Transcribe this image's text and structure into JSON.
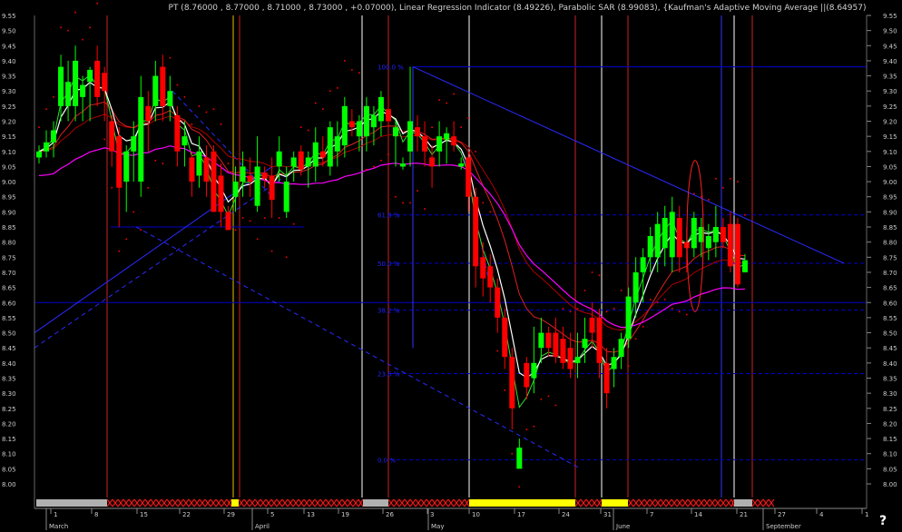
{
  "header": {
    "title": "PT (8.76000 , 8.77000 , 8.71000 , 8.73000 , +0.07000), Linear Regression Indicator (8.49226), Parabolic SAR (8.99083), {Kaufman's Adaptive Moving Average ||(8.64957)"
  },
  "help_label": "?",
  "colors": {
    "background": "#000000",
    "up_candle": "#00ff00",
    "down_candle": "#ff0000",
    "fib_line": "#0000cc",
    "regression": "#ffffff",
    "kama": "#ff00ff",
    "sar": "#ff0000",
    "vline_white": "#ffffff",
    "vline_red": "#cc2222",
    "vline_yellow": "#e8c000",
    "vline_blue": "#3333ff",
    "grid_label": "#cccccc"
  },
  "chart_data": {
    "type": "candlestick",
    "y_ticks": [
      "9.55",
      "9.50",
      "9.45",
      "9.40",
      "9.35",
      "9.30",
      "9.25",
      "9.20",
      "9.15",
      "9.10",
      "9.05",
      "9.00",
      "8.95",
      "8.90",
      "8.85",
      "8.80",
      "8.75",
      "8.70",
      "8.65",
      "8.60",
      "8.55",
      "8.50",
      "8.45",
      "8.40",
      "8.35",
      "8.30",
      "8.25",
      "8.20",
      "8.15",
      "8.10",
      "8.05",
      "8.00"
    ],
    "ylim": [
      7.96,
      9.58
    ],
    "fib_labels": [
      "100.0 %",
      "61.8 %",
      "50.0 %",
      "38.2 %",
      "23.6 %",
      "0.0 %"
    ],
    "fib_levels": [
      9.38,
      8.89,
      8.73,
      8.575,
      8.365,
      8.08
    ],
    "month_labels": [
      "March",
      "April",
      "May",
      "June",
      "September"
    ],
    "day_labels": [
      "1",
      "8",
      "15",
      "22",
      "29",
      "5",
      "13",
      "19",
      "26",
      "3",
      "10",
      "17",
      "24",
      "31",
      "7",
      "14",
      "21",
      "27",
      "4",
      "1"
    ],
    "candles": [
      {
        "o": 9.08,
        "h": 9.12,
        "l": 9.06,
        "c": 9.1
      },
      {
        "o": 9.1,
        "h": 9.17,
        "l": 9.08,
        "c": 9.13
      },
      {
        "o": 9.13,
        "h": 9.2,
        "l": 9.08,
        "c": 9.17
      },
      {
        "o": 9.25,
        "h": 9.42,
        "l": 9.2,
        "c": 9.38
      },
      {
        "o": 9.25,
        "h": 9.4,
        "l": 9.2,
        "c": 9.33
      },
      {
        "o": 9.25,
        "h": 9.45,
        "l": 9.2,
        "c": 9.4
      },
      {
        "o": 9.28,
        "h": 9.35,
        "l": 9.2,
        "c": 9.32
      },
      {
        "o": 9.33,
        "h": 9.38,
        "l": 9.2,
        "c": 9.37
      },
      {
        "o": 9.4,
        "h": 9.45,
        "l": 9.25,
        "c": 9.28
      },
      {
        "o": 9.36,
        "h": 9.38,
        "l": 9.2,
        "c": 9.3
      },
      {
        "o": 9.2,
        "h": 9.22,
        "l": 9.05,
        "c": 9.1
      },
      {
        "o": 9.15,
        "h": 9.18,
        "l": 8.85,
        "c": 8.98
      },
      {
        "o": 9.0,
        "h": 9.12,
        "l": 8.9,
        "c": 9.1
      },
      {
        "o": 9.1,
        "h": 9.2,
        "l": 9.0,
        "c": 9.15
      },
      {
        "o": 9.0,
        "h": 9.35,
        "l": 8.95,
        "c": 9.28
      },
      {
        "o": 9.25,
        "h": 9.3,
        "l": 9.1,
        "c": 9.2
      },
      {
        "o": 9.25,
        "h": 9.4,
        "l": 9.2,
        "c": 9.35
      },
      {
        "o": 9.38,
        "h": 9.42,
        "l": 9.2,
        "c": 9.25
      },
      {
        "o": 9.25,
        "h": 9.35,
        "l": 9.2,
        "c": 9.3
      },
      {
        "o": 9.22,
        "h": 9.25,
        "l": 9.05,
        "c": 9.1
      },
      {
        "o": 9.12,
        "h": 9.2,
        "l": 9.05,
        "c": 9.15
      },
      {
        "o": 9.08,
        "h": 9.1,
        "l": 8.95,
        "c": 9.0
      },
      {
        "o": 9.02,
        "h": 9.15,
        "l": 8.98,
        "c": 9.1
      },
      {
        "o": 9.08,
        "h": 9.12,
        "l": 8.95,
        "c": 9.0
      },
      {
        "o": 9.1,
        "h": 9.12,
        "l": 8.95,
        "c": 8.9
      },
      {
        "o": 9.02,
        "h": 9.06,
        "l": 8.85,
        "c": 8.9
      },
      {
        "o": 8.9,
        "h": 8.92,
        "l": 8.84,
        "c": 8.84
      },
      {
        "o": 8.95,
        "h": 9.05,
        "l": 8.9,
        "c": 9.0
      },
      {
        "o": 9.0,
        "h": 9.1,
        "l": 8.95,
        "c": 9.05
      },
      {
        "o": 9.02,
        "h": 9.08,
        "l": 8.95,
        "c": 9.0
      },
      {
        "o": 8.92,
        "h": 9.15,
        "l": 8.9,
        "c": 9.05
      },
      {
        "o": 9.03,
        "h": 9.05,
        "l": 8.98,
        "c": 9.01
      },
      {
        "o": 9.02,
        "h": 9.08,
        "l": 8.88,
        "c": 8.94
      },
      {
        "o": 9.05,
        "h": 9.15,
        "l": 9.0,
        "c": 9.1
      },
      {
        "o": 8.9,
        "h": 9.05,
        "l": 8.88,
        "c": 9.0
      },
      {
        "o": 9.05,
        "h": 9.1,
        "l": 9.0,
        "c": 9.08
      },
      {
        "o": 9.1,
        "h": 9.12,
        "l": 9.02,
        "c": 9.04
      },
      {
        "o": 9.05,
        "h": 9.1,
        "l": 8.98,
        "c": 9.08
      },
      {
        "o": 9.05,
        "h": 9.18,
        "l": 9.0,
        "c": 9.13
      },
      {
        "o": 9.1,
        "h": 9.15,
        "l": 9.05,
        "c": 9.08
      },
      {
        "o": 9.05,
        "h": 9.2,
        "l": 9.02,
        "c": 9.18
      },
      {
        "o": 9.1,
        "h": 9.2,
        "l": 9.05,
        "c": 9.15
      },
      {
        "o": 9.12,
        "h": 9.28,
        "l": 9.08,
        "c": 9.25
      },
      {
        "o": 9.2,
        "h": 9.24,
        "l": 9.15,
        "c": 9.18
      },
      {
        "o": 9.15,
        "h": 9.22,
        "l": 9.1,
        "c": 9.2
      },
      {
        "o": 9.15,
        "h": 9.28,
        "l": 9.1,
        "c": 9.25
      },
      {
        "o": 9.18,
        "h": 9.25,
        "l": 9.12,
        "c": 9.22
      },
      {
        "o": 9.2,
        "h": 9.3,
        "l": 9.15,
        "c": 9.28
      },
      {
        "o": 9.24,
        "h": 9.28,
        "l": 9.18,
        "c": 9.2
      },
      {
        "o": 9.15,
        "h": 9.2,
        "l": 9.05,
        "c": 9.18
      },
      {
        "o": 9.05,
        "h": 9.08,
        "l": 9.04,
        "c": 9.06
      },
      {
        "o": 9.1,
        "h": 9.38,
        "l": 9.05,
        "c": 9.2
      },
      {
        "o": 9.18,
        "h": 9.22,
        "l": 9.1,
        "c": 9.15
      },
      {
        "o": 9.15,
        "h": 9.2,
        "l": 9.05,
        "c": 9.1
      },
      {
        "o": 9.08,
        "h": 9.12,
        "l": 8.98,
        "c": 9.05
      },
      {
        "o": 9.1,
        "h": 9.2,
        "l": 9.05,
        "c": 9.15
      },
      {
        "o": 9.14,
        "h": 9.18,
        "l": 9.06,
        "c": 9.16
      },
      {
        "o": 9.15,
        "h": 9.2,
        "l": 9.1,
        "c": 9.12
      },
      {
        "o": 9.05,
        "h": 9.08,
        "l": 9.04,
        "c": 9.06
      },
      {
        "o": 9.08,
        "h": 9.1,
        "l": 8.9,
        "c": 8.95
      },
      {
        "o": 8.95,
        "h": 8.98,
        "l": 8.65,
        "c": 8.72
      },
      {
        "o": 8.75,
        "h": 8.8,
        "l": 8.62,
        "c": 8.68
      },
      {
        "o": 8.72,
        "h": 8.76,
        "l": 8.6,
        "c": 8.65
      },
      {
        "o": 8.65,
        "h": 8.68,
        "l": 8.5,
        "c": 8.55
      },
      {
        "o": 8.55,
        "h": 8.58,
        "l": 8.38,
        "c": 8.42
      },
      {
        "o": 8.42,
        "h": 8.45,
        "l": 8.18,
        "c": 8.25
      },
      {
        "o": 8.05,
        "h": 8.15,
        "l": 8.08,
        "c": 8.12
      },
      {
        "o": 8.4,
        "h": 8.42,
        "l": 8.28,
        "c": 8.32
      },
      {
        "o": 8.35,
        "h": 8.52,
        "l": 8.3,
        "c": 8.4
      },
      {
        "o": 8.45,
        "h": 8.55,
        "l": 8.4,
        "c": 8.5
      },
      {
        "o": 8.5,
        "h": 8.52,
        "l": 8.42,
        "c": 8.45
      },
      {
        "o": 8.5,
        "h": 8.55,
        "l": 8.4,
        "c": 8.42
      },
      {
        "o": 8.48,
        "h": 8.52,
        "l": 8.38,
        "c": 8.4
      },
      {
        "o": 8.45,
        "h": 8.5,
        "l": 8.35,
        "c": 8.38
      },
      {
        "o": 8.4,
        "h": 8.5,
        "l": 8.35,
        "c": 8.42
      },
      {
        "o": 8.45,
        "h": 8.55,
        "l": 8.4,
        "c": 8.48
      },
      {
        "o": 8.55,
        "h": 8.6,
        "l": 8.45,
        "c": 8.5
      },
      {
        "o": 8.55,
        "h": 8.58,
        "l": 8.35,
        "c": 8.4
      },
      {
        "o": 8.4,
        "h": 8.45,
        "l": 8.25,
        "c": 8.3
      },
      {
        "o": 8.38,
        "h": 8.45,
        "l": 8.32,
        "c": 8.42
      },
      {
        "o": 8.42,
        "h": 8.5,
        "l": 8.38,
        "c": 8.48
      },
      {
        "o": 8.48,
        "h": 8.65,
        "l": 8.45,
        "c": 8.62
      },
      {
        "o": 8.6,
        "h": 8.75,
        "l": 8.55,
        "c": 8.7
      },
      {
        "o": 8.7,
        "h": 8.78,
        "l": 8.6,
        "c": 8.75
      },
      {
        "o": 8.75,
        "h": 8.85,
        "l": 8.7,
        "c": 8.82
      },
      {
        "o": 8.75,
        "h": 8.9,
        "l": 8.7,
        "c": 8.86
      },
      {
        "o": 8.78,
        "h": 8.92,
        "l": 8.72,
        "c": 8.88
      },
      {
        "o": 8.75,
        "h": 8.95,
        "l": 8.7,
        "c": 8.9
      },
      {
        "o": 8.88,
        "h": 8.92,
        "l": 8.7,
        "c": 8.75
      },
      {
        "o": 8.8,
        "h": 8.85,
        "l": 8.7,
        "c": 8.78
      },
      {
        "o": 8.78,
        "h": 8.9,
        "l": 8.75,
        "c": 8.88
      },
      {
        "o": 8.8,
        "h": 8.88,
        "l": 8.75,
        "c": 8.85
      },
      {
        "o": 8.78,
        "h": 8.86,
        "l": 8.74,
        "c": 8.82
      },
      {
        "o": 8.8,
        "h": 8.92,
        "l": 8.75,
        "c": 8.85
      },
      {
        "o": 8.85,
        "h": 8.88,
        "l": 8.78,
        "c": 8.8
      },
      {
        "o": 8.86,
        "h": 8.9,
        "l": 8.7,
        "c": 8.72
      },
      {
        "o": 8.86,
        "h": 8.88,
        "l": 8.65,
        "c": 8.66
      },
      {
        "o": 8.7,
        "h": 8.76,
        "l": 8.7,
        "c": 8.74
      }
    ]
  }
}
